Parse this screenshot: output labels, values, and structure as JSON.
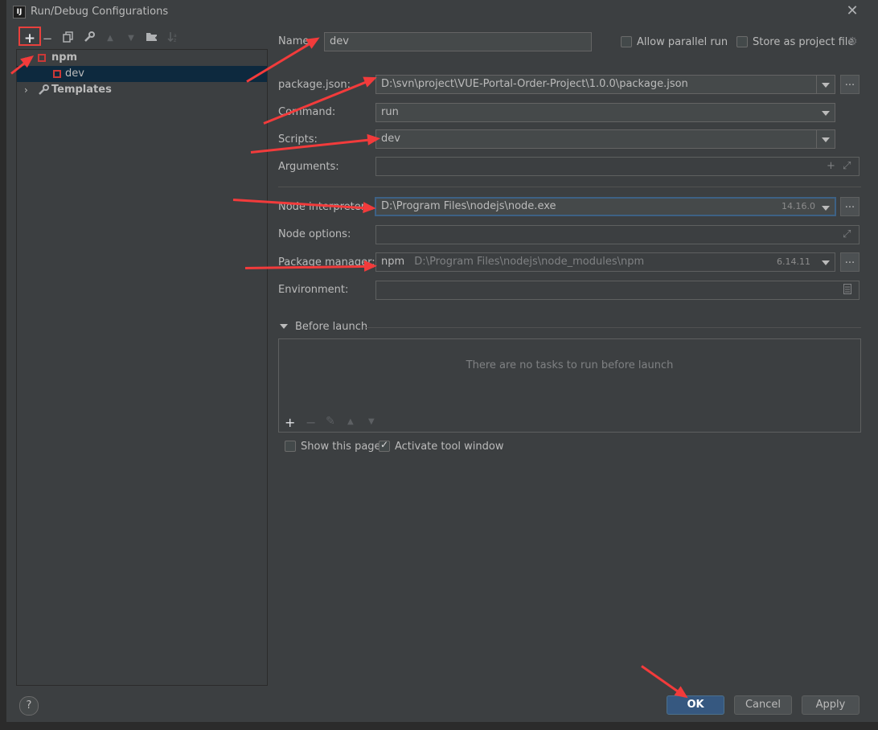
{
  "window": {
    "title": "Run/Debug Configurations",
    "app_icon": "intellij-icon",
    "close": "✕"
  },
  "toolbar": {
    "add": "+",
    "remove": "−",
    "copy": "copy-icon",
    "edit_defaults": "wrench-icon",
    "move_up": "▲",
    "move_down": "▼",
    "new_folder": "folder-add-icon",
    "sort": "sort-icon"
  },
  "tree": {
    "items": [
      {
        "label": "npm",
        "type": "group",
        "expanded": true
      },
      {
        "label": "dev",
        "type": "config",
        "selected": true
      },
      {
        "label": "Templates",
        "type": "group",
        "expanded": false
      }
    ]
  },
  "form": {
    "name_label": "Name:",
    "name_value": "dev",
    "allow_parallel_label": "Allow parallel run",
    "allow_parallel_checked": false,
    "store_project_label": "Store as project file",
    "store_project_checked": false,
    "package_json_label": "package.json:",
    "package_json_value": "D:\\svn\\project\\VUE-Portal-Order-Project\\1.0.0\\package.json",
    "command_label": "Command:",
    "command_value": "run",
    "scripts_label": "Scripts:",
    "scripts_value": "dev",
    "arguments_label": "Arguments:",
    "arguments_value": "",
    "node_interpreter_label": "Node interpreter:",
    "node_interpreter_value": "D:\\Program Files\\nodejs\\node.exe",
    "node_interpreter_version": "14.16.0",
    "node_options_label": "Node options:",
    "node_options_value": "",
    "package_manager_label": "Package manager:",
    "package_manager_name": "npm",
    "package_manager_path": "D:\\Program Files\\nodejs\\node_modules\\npm",
    "package_manager_version": "6.14.11",
    "environment_label": "Environment:",
    "environment_value": "",
    "browse_button": "..."
  },
  "before_launch": {
    "header": "Before launch",
    "empty_text": "There are no tasks to run before launch",
    "add": "+",
    "remove": "−",
    "edit": "✎",
    "up": "▲",
    "down": "▼"
  },
  "options": {
    "show_page_label": "Show this page",
    "show_page_checked": false,
    "activate_tool_label": "Activate tool window",
    "activate_tool_checked": true
  },
  "footer": {
    "help": "?",
    "ok": "OK",
    "cancel": "Cancel",
    "apply": "Apply"
  },
  "colors": {
    "accent": "#365880",
    "annotation": "#f23b3b",
    "npm_red": "#cb3837",
    "selection": "#0d293e"
  }
}
